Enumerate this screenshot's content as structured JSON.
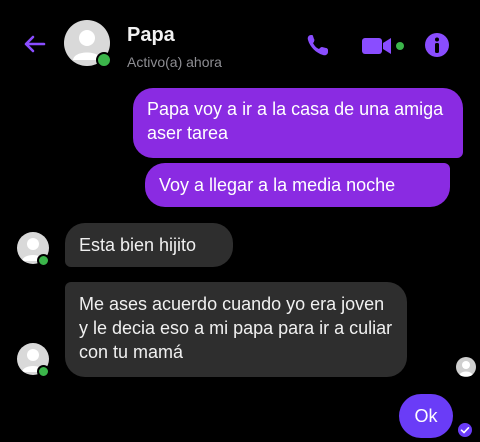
{
  "header": {
    "contact_name": "Papa",
    "status": "Activo(a) ahora",
    "back_icon": "back-arrow-icon",
    "call_icon": "phone-icon",
    "video_icon": "video-camera-icon",
    "info_icon": "info-icon",
    "accent_color": "#8a2be2"
  },
  "messages": [
    {
      "from": "me",
      "text": "Papa voy a ir a la casa de una amiga aser tarea"
    },
    {
      "from": "me",
      "text": "Voy a llegar a la media noche"
    },
    {
      "from": "contact",
      "text": "Esta bien hijito"
    },
    {
      "from": "contact",
      "text": "Me ases acuerdo cuando yo era joven y le decia eso a mi papa para ir a culiar con tu mamá"
    },
    {
      "from": "me",
      "text": "Ok"
    }
  ],
  "colors": {
    "outgoing_bubble": "#8a2be2",
    "last_outgoing_bubble": "#6a3cf7",
    "incoming_bubble": "#2e2e2e",
    "online_indicator": "#3bb54a"
  }
}
